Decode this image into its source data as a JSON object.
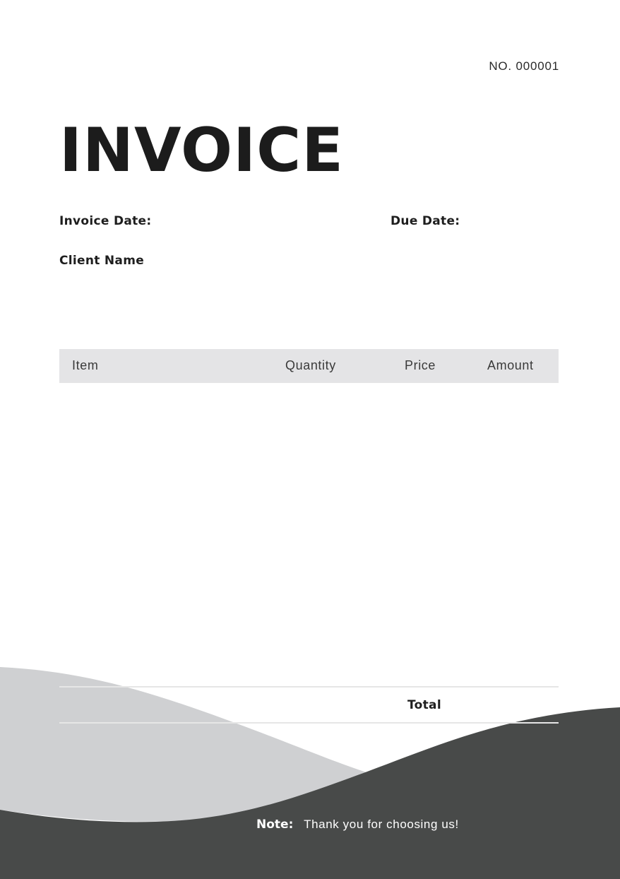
{
  "invoice": {
    "number": "NO. 000001",
    "title": "INVOICE",
    "invoice_date_label": "Invoice Date:",
    "due_date_label": "Due Date:",
    "client_name_label": "Client Name"
  },
  "table": {
    "columns": [
      "Item",
      "Quantity",
      "Price",
      "Amount"
    ],
    "rows": []
  },
  "summary": {
    "total_label": "Total"
  },
  "footer": {
    "note_label": "Note:",
    "note_text": "Thank you for choosing us!"
  },
  "colors": {
    "header_fill": "#e4e4e6",
    "wave_light": "#cfd0d2",
    "wave_dark": "#484a49",
    "text_dark": "#1e1e1e"
  }
}
